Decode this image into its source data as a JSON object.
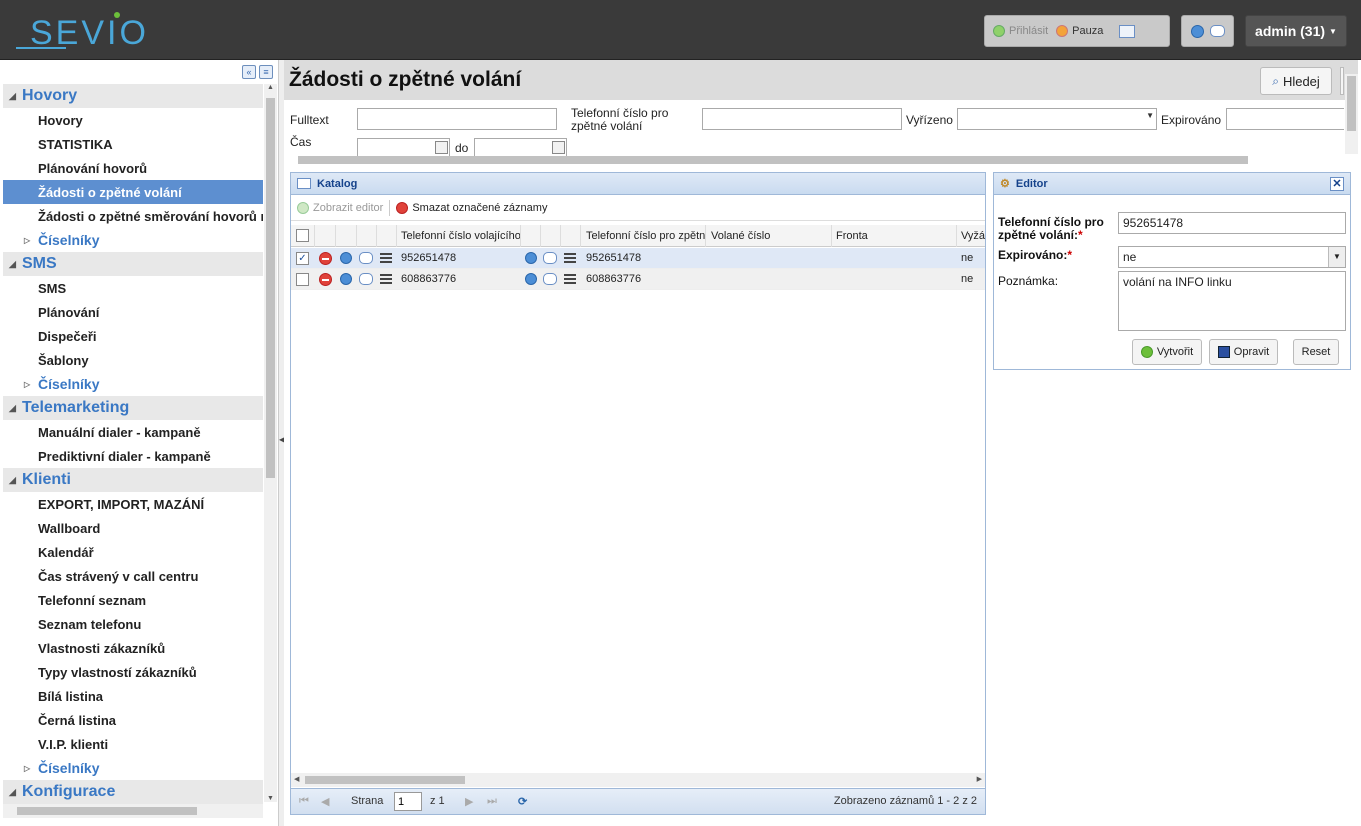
{
  "brand": {
    "logo_text": "SEVIO"
  },
  "topbar": {
    "login_label": "Přihlásit",
    "pause_label": "Pauza",
    "user_label": "admin (31)"
  },
  "sidebar": {
    "groups": [
      {
        "label": "Hovory",
        "items": [
          "Hovory",
          "STATISTIKA",
          "Plánování hovorů",
          "Žádosti o zpětné volání",
          "Žádosti o zpětné směrování hovorů n"
        ],
        "sub": "Číselníky"
      },
      {
        "label": "SMS",
        "items": [
          "SMS",
          "Plánování",
          "Dispečeři",
          "Šablony"
        ],
        "sub": "Číselníky"
      },
      {
        "label": "Telemarketing",
        "items": [
          "Manuální dialer - kampaně",
          "Prediktivní dialer - kampaně"
        ]
      },
      {
        "label": "Klienti",
        "items": [
          "EXPORT, IMPORT, MAZÁNÍ",
          "Wallboard",
          "Kalendář",
          "Čas strávený v call centru",
          "Telefonní seznam",
          "Seznam telefonu",
          "Vlastnosti zákazníků",
          "Typy vlastností zákazníků",
          "Bílá listina",
          "Černá listina",
          "V.I.P. klienti"
        ],
        "sub": "Číselníky"
      },
      {
        "label": "Konfigurace"
      }
    ]
  },
  "main": {
    "title": "Žádosti o zpětné volání",
    "search_label": "Hledej",
    "filters": {
      "fulltext_label": "Fulltext",
      "phone_label_1": "Telefonní číslo pro",
      "phone_label_2": "zpětné volání",
      "resolved_label": "Vyřízeno",
      "expired_label": "Expirováno",
      "time_label": "Čas",
      "to_label": "do"
    }
  },
  "catalog": {
    "title": "Katalog",
    "show_editor": "Zobrazit editor",
    "delete_marked": "Smazat označené záznamy",
    "columns": [
      "Telefonní číslo volajícího",
      "Telefonní číslo pro zpětné",
      "Volané číslo",
      "Fronta",
      "Vyžá"
    ],
    "rows": [
      {
        "caller": "952651478",
        "callback": "952651478",
        "called": "",
        "queue": "",
        "required": "ne",
        "checked": true
      },
      {
        "caller": "608863776",
        "callback": "608863776",
        "called": "",
        "queue": "",
        "required": "ne",
        "checked": false
      }
    ],
    "pager": {
      "page_label": "Strana",
      "page_value": "1",
      "of_label": "z 1",
      "summary": "Zobrazeno záznamů 1 - 2 z 2"
    }
  },
  "editor": {
    "title": "Editor",
    "phone_label_1": "Telefonní číslo pro",
    "phone_label_2": "zpětné volání:",
    "phone_value": "952651478",
    "expired_label": "Expirováno:",
    "expired_value": "ne",
    "note_label": "Poznámka:",
    "note_value": "volání na INFO linku",
    "create_label": "Vytvořit",
    "fix_label": "Opravit",
    "reset_label": "Reset"
  },
  "colors": {
    "accent": "#5d8fd0",
    "link": "#3a78c4",
    "topbar": "#3a3a3a",
    "panel_border": "#9fb8d8"
  }
}
